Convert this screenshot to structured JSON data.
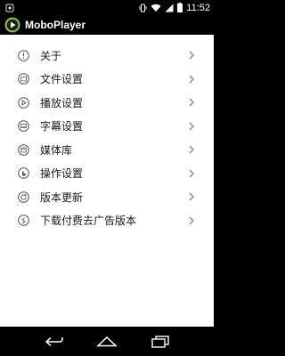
{
  "status_bar": {
    "time": "11:52"
  },
  "app": {
    "title": "MoboPlayer"
  },
  "menu": {
    "items": [
      {
        "label": "关于",
        "icon": "info-icon"
      },
      {
        "label": "文件设置",
        "icon": "folder-icon"
      },
      {
        "label": "播放设置",
        "icon": "play-icon"
      },
      {
        "label": "字幕设置",
        "icon": "subtitle-icon"
      },
      {
        "label": "媒体库",
        "icon": "media-library-icon"
      },
      {
        "label": "操作设置",
        "icon": "hand-icon"
      },
      {
        "label": "版本更新",
        "icon": "refresh-icon"
      },
      {
        "label": "下载付费去广告版本",
        "icon": "dollar-icon"
      }
    ]
  },
  "nav_bar": {
    "buttons": [
      "back",
      "home",
      "recent-apps"
    ]
  },
  "colors": {
    "background": "#ffffff",
    "bar": "#000000",
    "text": "#1a1a1a",
    "icon": "#555555",
    "accent": "#7bc142"
  }
}
